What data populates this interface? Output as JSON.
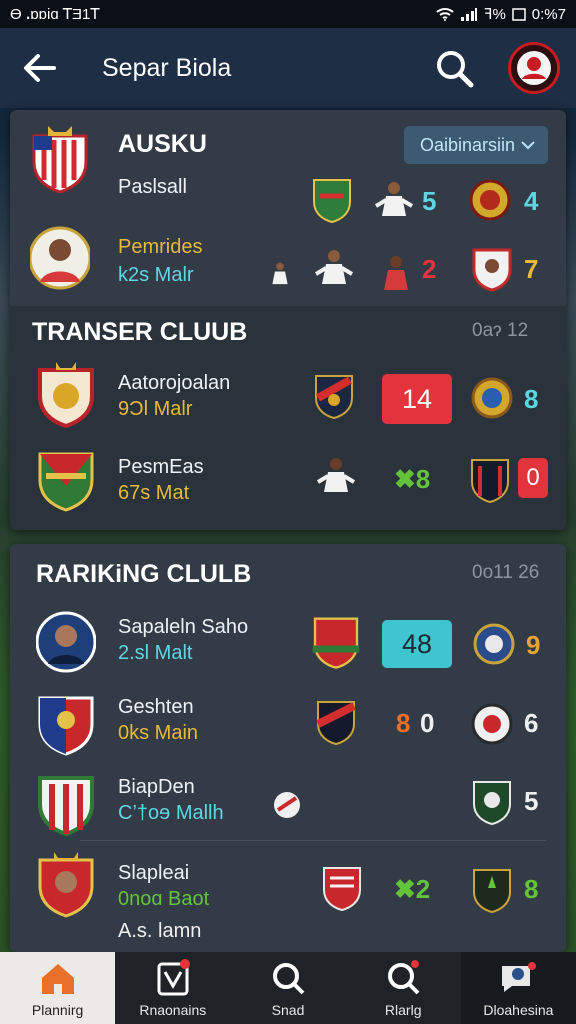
{
  "status_bar": {
    "left_text": "Ɵ ꓸɒɒiɑ  ꓔƎ1ꓔ",
    "battery": "ꟻ%",
    "time": "0:%7"
  },
  "header": {
    "title": "Separ Biola"
  },
  "section_top": {
    "title": "AUSKU",
    "dropdown_label": "Oaibinarsiin",
    "rows": [
      {
        "name": "Paslsall",
        "sub": "",
        "score_a": "5",
        "score_b": "4"
      },
      {
        "name": "Pemrides",
        "sub": "k2s Malr",
        "score_a": "2",
        "score_b": "7"
      }
    ]
  },
  "section_transfer": {
    "title": "TRANSER CLUUB",
    "date": "0aɂ 12",
    "rows": [
      {
        "name": "Aatorojoalan",
        "sub": "9Ɔl Malr",
        "badge": "14",
        "score_b": "8"
      },
      {
        "name": "PesmEas",
        "sub": "67s Mat",
        "score_a": "✖8",
        "score_b": "0"
      }
    ]
  },
  "section_ranking": {
    "title": "RARIKiNG CLULB",
    "date": "0o11 26",
    "rows": [
      {
        "name": "Sapaleln Saho",
        "sub": "2.sl Malt",
        "badge": "48",
        "score_b": "9"
      },
      {
        "name": "Geshten",
        "sub": "0ks Main",
        "score_a": "8",
        "score_mid": "0",
        "score_b": "6"
      },
      {
        "name": "BiapDen",
        "sub": "C’†oɘ Mallh",
        "score_b": "5"
      },
      {
        "name": "Slapleai",
        "sub": "0noɑ Baot",
        "extra": "A.s. lamn",
        "score_a": "✖2",
        "score_b": "8"
      }
    ]
  },
  "bottom_nav": [
    {
      "label": "Plannirg",
      "icon": "home-icon"
    },
    {
      "label": "Rnaonains",
      "icon": "whistle-icon"
    },
    {
      "label": "Snad",
      "icon": "search-chat-icon"
    },
    {
      "label": "Rlarlg",
      "icon": "search-badge-icon"
    },
    {
      "label": "Dloahesina",
      "icon": "chat-avatar-icon"
    }
  ],
  "colors": {
    "accent_red": "#e3333d",
    "accent_teal": "#3ec5cf",
    "yellow": "#e6b93a",
    "green": "#63c43c"
  }
}
